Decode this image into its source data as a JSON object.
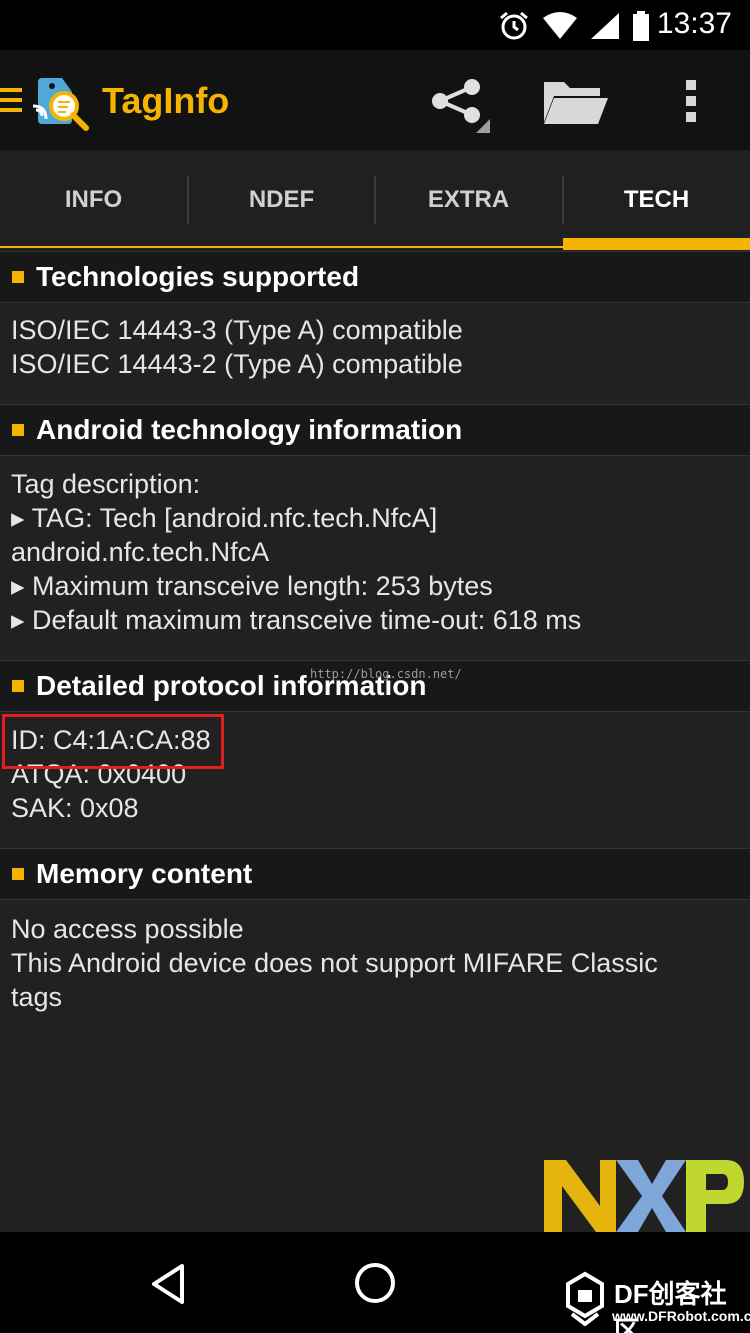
{
  "status_bar": {
    "time": "13:37"
  },
  "app_bar": {
    "title": "TagInfo"
  },
  "tabs": [
    {
      "label": "INFO",
      "active": false
    },
    {
      "label": "NDEF",
      "active": false
    },
    {
      "label": "EXTRA",
      "active": false
    },
    {
      "label": "TECH",
      "active": true
    }
  ],
  "sections": {
    "technologies": {
      "title": "Technologies supported",
      "lines": [
        "ISO/IEC 14443-3 (Type A) compatible",
        "ISO/IEC 14443-2 (Type A) compatible"
      ]
    },
    "android": {
      "title": "Android technology information",
      "lines": [
        "Tag description:",
        "▸ TAG: Tech [android.nfc.tech.NfcA]",
        "android.nfc.tech.NfcA",
        "▸ Maximum transceive length: 253 bytes",
        "▸ Default maximum transceive time-out: 618 ms"
      ]
    },
    "protocol": {
      "title": "Detailed protocol information",
      "lines": [
        "ID: C4:1A:CA:88",
        "ATQA: 0x0400",
        "SAK: 0x08"
      ]
    },
    "memory": {
      "title": "Memory content",
      "lines": [
        "No access possible",
        "This Android device does not support MIFARE Classic",
        "tags"
      ]
    }
  },
  "watermark_url": "http://blog.csdn.net/",
  "nxp_logo_text": "NXP",
  "df_watermark": {
    "brand": "DF创客社区",
    "site": "www.DFRobot.com.cn"
  },
  "colors": {
    "accent": "#F5B400",
    "highlight": "#E02020",
    "background": "#212121"
  }
}
